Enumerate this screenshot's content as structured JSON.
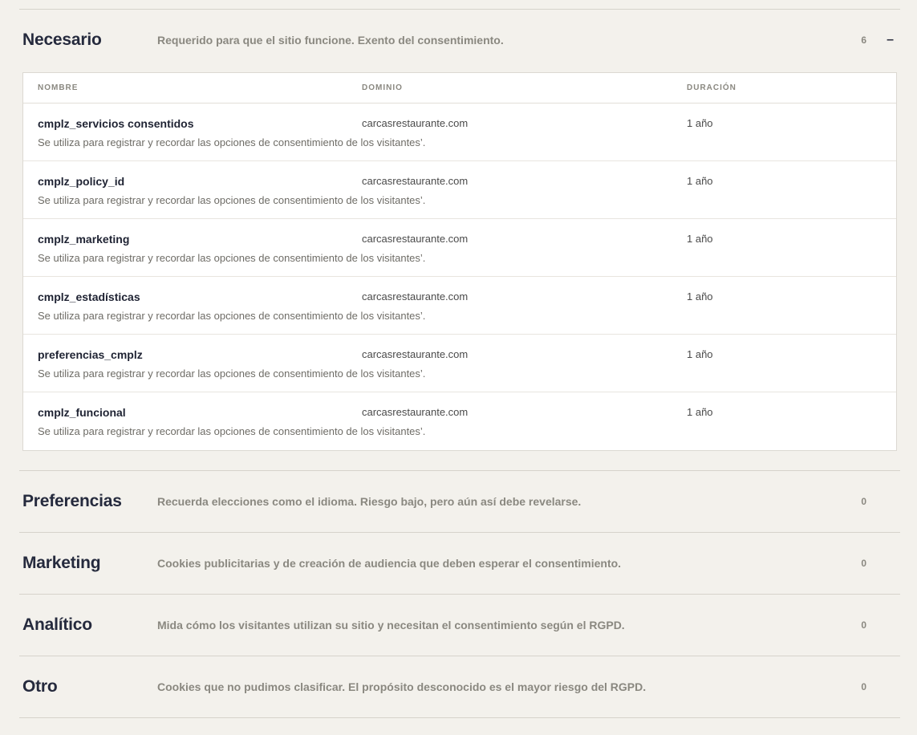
{
  "categories": [
    {
      "title": "Necesario",
      "description": "Requerido para que el sitio funcione. Exento del consentimiento.",
      "count": "6",
      "toggle": "–",
      "table": {
        "headers": [
          "NOMBRE",
          "DOMINIO",
          "DURACIÓN"
        ],
        "rows": [
          {
            "name": "cmplz_servicios consentidos",
            "domain": "carcasrestaurante.com",
            "duration": "1 año",
            "description": "Se utiliza para registrar y recordar las opciones de consentimiento de los visitantes’."
          },
          {
            "name": "cmplz_policy_id",
            "domain": "carcasrestaurante.com",
            "duration": "1 año",
            "description": "Se utiliza para registrar y recordar las opciones de consentimiento de los visitantes’."
          },
          {
            "name": "cmplz_marketing",
            "domain": "carcasrestaurante.com",
            "duration": "1 año",
            "description": "Se utiliza para registrar y recordar las opciones de consentimiento de los visitantes’."
          },
          {
            "name": "cmplz_estadísticas",
            "domain": "carcasrestaurante.com",
            "duration": "1 año",
            "description": "Se utiliza para registrar y recordar las opciones de consentimiento de los visitantes’."
          },
          {
            "name": "preferencias_cmplz",
            "domain": "carcasrestaurante.com",
            "duration": "1 año",
            "description": "Se utiliza para registrar y recordar las opciones de consentimiento de los visitantes’."
          },
          {
            "name": "cmplz_funcional",
            "domain": "carcasrestaurante.com",
            "duration": "1 año",
            "description": "Se utiliza para registrar y recordar las opciones de consentimiento de los visitantes’."
          }
        ]
      }
    },
    {
      "title": "Preferencias",
      "description": "Recuerda elecciones como el idioma. Riesgo bajo, pero aún así debe revelarse.",
      "count": "0"
    },
    {
      "title": "Marketing",
      "description": "Cookies publicitarias y de creación de audiencia que deben esperar el consentimiento.",
      "count": "0"
    },
    {
      "title": "Analítico",
      "description": "Mida cómo los visitantes utilizan su sitio y necesitan el consentimiento según el RGPD.",
      "count": "0"
    },
    {
      "title": "Otro",
      "description": "Cookies que no pudimos clasificar. El propósito desconocido es el mayor riesgo del RGPD.",
      "count": "0"
    }
  ]
}
